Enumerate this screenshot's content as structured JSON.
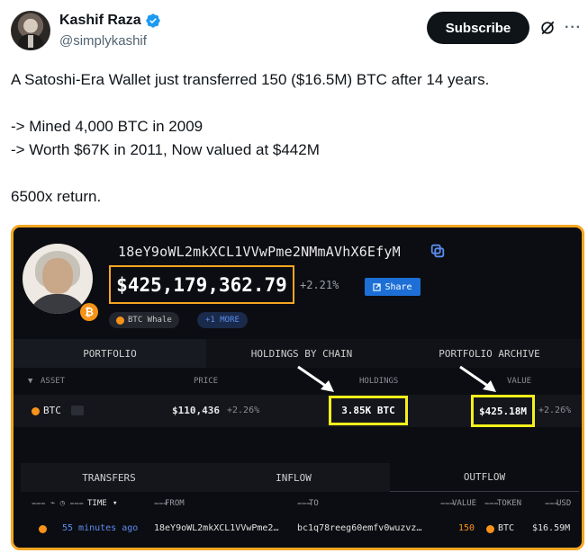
{
  "author": {
    "display_name": "Kashif Raza",
    "handle": "@simplykashif",
    "verified": true
  },
  "actions": {
    "subscribe_label": "Subscribe",
    "grok_icon": "grok-icon",
    "more_icon": "more-icon"
  },
  "tweet": {
    "lines": [
      "A Satoshi-Era Wallet just transferred 150 ($16.5M) BTC after 14 years.",
      "",
      "-> Mined 4,000 BTC in 2009",
      "-> Worth $67K in 2011, Now valued at $442M",
      "",
      "6500x return."
    ]
  },
  "media": {
    "address": "18eY9oWL2mkXCL1VVwPme2NMmAVhX6EfyM",
    "balance": "$425,179,362.79",
    "balance_change": "+2.21%",
    "share_label": "Share",
    "badge_label": "BTC Whale",
    "more_label": "+1 MORE",
    "badge_symbol": "₿",
    "top_tabs": [
      "PORTFOLIO",
      "HOLDINGS BY CHAIN",
      "PORTFOLIO ARCHIVE"
    ],
    "columns": {
      "asset": "ASSET",
      "price": "PRICE",
      "holdings": "HOLDINGS",
      "value": "VALUE"
    },
    "asset_row": {
      "asset": "BTC",
      "price": "$110,436",
      "price_change": "+2.26%",
      "holdings": "3.85K BTC",
      "value": "$425.18M",
      "value_change": "+2.26%"
    },
    "bottom_tabs": [
      "TRANSFERS",
      "INFLOW",
      "OUTFLOW"
    ],
    "tx_columns": {
      "time": "TIME",
      "from": "FROM",
      "to": "TO",
      "value": "VALUE",
      "token": "TOKEN",
      "usd": "USD"
    },
    "tx_row": {
      "time": "55 minutes ago",
      "from": "18eY9oWL2mkXCL1VVwPme2…",
      "to": "bc1q78reeg60emfv0wuzvz…",
      "value": "150",
      "token": "BTC",
      "usd": "$16.59M"
    },
    "colors": {
      "highlight_orange": "#f5a623",
      "highlight_yellow": "#f5f01b",
      "bitcoin": "#f7931a",
      "link_blue": "#5b8def"
    }
  }
}
